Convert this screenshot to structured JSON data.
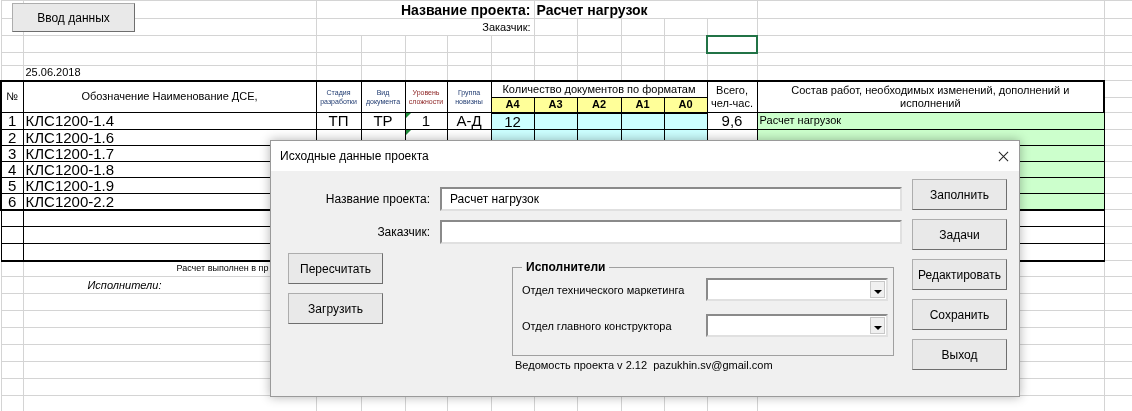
{
  "sheet": {
    "button": "Ввод данных",
    "project_label": "Название проекта:",
    "project_name": "Расчет нагрузок",
    "customer_label": "Заказчик:",
    "date": "25.06.2018",
    "selection_visible": true,
    "columns": [
      "№",
      "Обозначение Наименование ДСЕ,",
      "Стадия разработки",
      "Вид документа",
      "Уровень сложности",
      "Группа новизны",
      "Количество документов по форматам",
      "Всего, чел-час.",
      "Состав работ, необходимых изменений, дополнений и исполнений"
    ],
    "formats": [
      "A4",
      "A3",
      "A2",
      "A1",
      "A0"
    ],
    "rows": [
      {
        "number": "1",
        "designation": "КЛС1200-1.4",
        "stage": "ТП",
        "doc_type": "ТР",
        "complexity": "1",
        "novelty": "А-Д",
        "a4": "12",
        "total": "9,6",
        "work": "Расчет нагрузок",
        "note": true
      },
      {
        "number": "2",
        "designation": "КЛС1200-1.6",
        "note": true
      },
      {
        "number": "3",
        "designation": "КЛС1200-1.7"
      },
      {
        "number": "4",
        "designation": "КЛС1200-1.8"
      },
      {
        "number": "5",
        "designation": "КЛС1200-1.9"
      },
      {
        "number": "6",
        "designation": "КЛС1200-2.2"
      }
    ],
    "footer_note": "Расчет выполнен в пр",
    "executors_label": "Исполнители:"
  },
  "dialog": {
    "title": "Исходные данные проекта",
    "fields": [
      {
        "label": "Название проекта:",
        "value": "Расчет нагрузок"
      },
      {
        "label": "Заказчик:"
      }
    ],
    "left_buttons": [
      "Пересчитать",
      "Загрузить"
    ],
    "right_buttons": [
      "Заполнить",
      "Задачи",
      "Редактировать",
      "Сохранить",
      "Выход"
    ],
    "group": {
      "title": "Исполнители",
      "combos": [
        {
          "label": "Отдел технического маркетинга"
        },
        {
          "label": "Отдел главного конструктора"
        }
      ]
    },
    "footer": "Ведомость проекта v 2.12  pazukhin.sv@gmail.com"
  }
}
